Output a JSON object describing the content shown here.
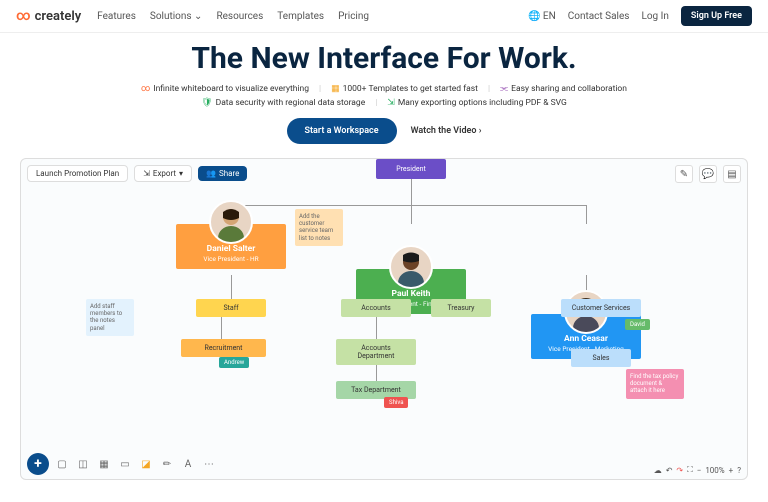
{
  "header": {
    "brand": "creately",
    "nav": [
      "Features",
      "Solutions",
      "Resources",
      "Templates",
      "Pricing"
    ],
    "lang": "EN",
    "contact": "Contact Sales",
    "login": "Log In",
    "signup": "Sign Up Free"
  },
  "hero": {
    "title": "The New Interface For Work.",
    "features": [
      "Infinite whiteboard to visualize everything",
      "1000+ Templates to get started fast",
      "Easy sharing and collaboration",
      "Data security with regional data storage",
      "Many exporting options including PDF & SVG"
    ],
    "cta": "Start a Workspace",
    "watch": "Watch the Video"
  },
  "canvas": {
    "doc_title": "Launch Promotion Plan",
    "export": "Export",
    "share": "Share",
    "zoom": "100%",
    "president": "President",
    "people": [
      {
        "name": "Daniel Salter",
        "title": "Vice President - HR"
      },
      {
        "name": "Paul Keith",
        "title": "Vice President - Finance"
      },
      {
        "name": "Ann Ceasar",
        "title": "Vice President - Marketing"
      }
    ],
    "boxes": {
      "staff": "Staff",
      "recruitment": "Recruitment",
      "accounts": "Accounts",
      "treasury": "Treasury",
      "acc_dept": "Accounts Department",
      "tax": "Tax Department",
      "cust": "Customer Services",
      "sales": "Sales"
    },
    "notes": {
      "n1": "Add staff members to the notes panel",
      "n2": "Add the customer service team list to notes",
      "n3": "Find the tax policy document & attach it here"
    },
    "tags": {
      "andrew": "Andrew",
      "shiva": "Shiva",
      "david": "David"
    }
  }
}
